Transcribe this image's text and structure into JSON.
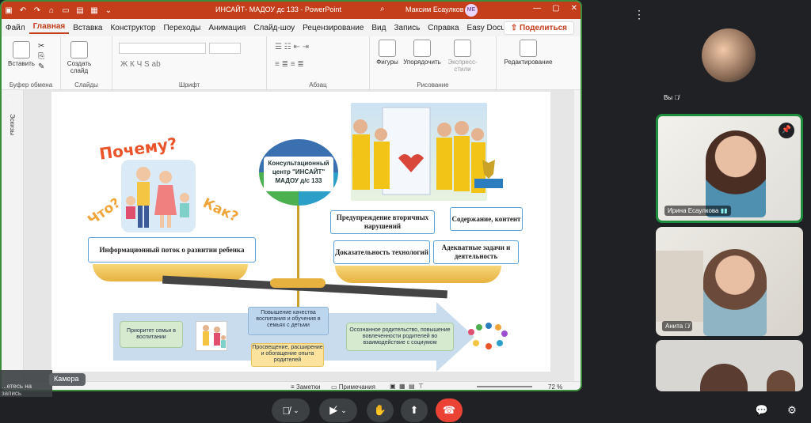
{
  "ppt": {
    "title": "ИНСАЙТ- МАДОУ дс 133  -  PowerPoint",
    "user": "Максим Есаулков",
    "initials": "МЕ",
    "tabs": [
      "Файл",
      "Главная",
      "Вставка",
      "Конструктор",
      "Переходы",
      "Анимация",
      "Слайд-шоу",
      "Рецензирование",
      "Вид",
      "Запись",
      "Справка",
      "Easy Document Creato"
    ],
    "share_label": "Поделиться",
    "ribbon": {
      "paste": "Вставить",
      "clipboard": "Буфер обмена",
      "new_slide": "Создать слайд",
      "slides": "Слайды",
      "font_group": "Шрифт",
      "font_buttons": "Ж  К  Ч  S  ab",
      "paragraph": "Абзац",
      "shapes": "Фигуры",
      "arrange": "Упорядочить",
      "styles": "Экспресс-стили",
      "drawing": "Рисование",
      "editing": "Редактирование"
    },
    "thumbs_label": "Эскизы",
    "status": {
      "notes": "Заметки",
      "comments": "Примечания",
      "zoom": "72 %"
    }
  },
  "slide": {
    "q_why": "Почему?",
    "q_what": "Что?",
    "q_how": "Как?",
    "center_title": "Консультационный центр \"ИНСАЙТ\" МАДОУ д/с 133",
    "info_flow": "Информационный поток о развитии ребенка",
    "prevention": "Предупреждение вторичных нарушений",
    "content": "Содержание, контент",
    "evidence": "Доказательность технологий",
    "tasks": "Адекватные задачи и деятельность",
    "priority": "Приоритет семьи в воспитании",
    "quality": "Повышение качества воспитания и обучения в семьях с детьми",
    "education": "Просвещение, расширение и обогащение опыта родителей",
    "parenting": "Осознанное родительство, повышение вовлеченности родителей во взаимодействие с социумом"
  },
  "meeting": {
    "you": "Вы",
    "p1": "Ирина Есаулкова",
    "p2": "Анита",
    "camera": "Камера",
    "recording": "...етесь на запись"
  }
}
